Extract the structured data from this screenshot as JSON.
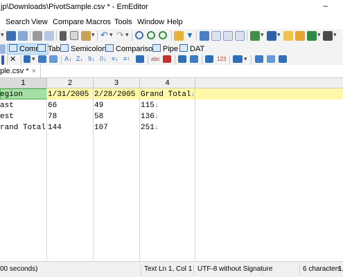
{
  "window": {
    "title": "jp\\Downloads\\PivotSample.csv * - EmEditor",
    "minimize": "–"
  },
  "menu": [
    "Search",
    "View",
    "Compare",
    "Macros",
    "Tools",
    "Window",
    "Help"
  ],
  "csv_toolbar": {
    "buttons": [
      "Comma",
      "Tab",
      "Semicolon",
      "Comparison",
      "Pipe",
      "DAT"
    ],
    "selected": "Comma"
  },
  "document_tab": {
    "label": "ple.csv *",
    "close": "×"
  },
  "columns": [
    "1",
    "2",
    "3",
    "4"
  ],
  "active_column": "1",
  "rows": [
    [
      "egion",
      "1/31/2005",
      "2/28/2005",
      "Grand Total"
    ],
    [
      "ast",
      "66",
      "49",
      "115"
    ],
    [
      "est",
      "78",
      "58",
      "136"
    ],
    [
      "rand Total",
      "144",
      "107",
      "251"
    ]
  ],
  "status": {
    "left": "00 seconds)",
    "mode": "Text",
    "position": "Ln 1, Col 1",
    "encoding": "UTF-8 without Signature",
    "chars": "6 characters",
    "extra": "1,"
  },
  "colors": {
    "selected_cell": "#a6dfa6",
    "header_row": "#fff8a8",
    "arrow": "#3b82d6"
  }
}
